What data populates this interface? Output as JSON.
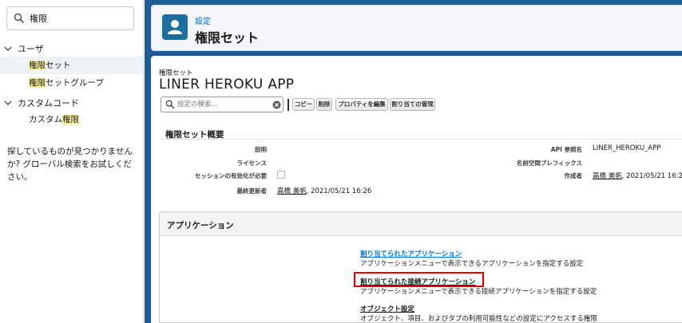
{
  "sidebar": {
    "search_value": "権限",
    "groups": [
      {
        "label": "ユーザ",
        "items": [
          "権限セット",
          "権限セットグループ"
        ]
      },
      {
        "label": "カスタムコード",
        "items": [
          "カスタム権限"
        ]
      }
    ],
    "help_text": "探しているものが見つかりませんか? グローバル検索をお試しください。"
  },
  "header": {
    "breadcrumb": "設定",
    "title": "権限セット"
  },
  "main": {
    "type_label": "権限セット",
    "name": "LINER HEROKU APP",
    "search_placeholder": "設定の検索...",
    "buttons": [
      "コピー",
      "削除",
      "プロパティを編集",
      "割り当ての管理"
    ],
    "overview": {
      "title": "権限セット概要",
      "left_fields": [
        {
          "label": "説明",
          "value": ""
        },
        {
          "label": "ライセンス",
          "value": ""
        },
        {
          "label": "セッションの有効化が必要",
          "value": ""
        },
        {
          "label": "最終更新者",
          "user": "高橋 美帆",
          "date": ", 2021/05/21 16:26"
        }
      ],
      "right_fields": [
        {
          "label": "API 参照名",
          "value": "LINER_HEROKU_APP"
        },
        {
          "label": "名前空間プレフィックス",
          "value": ""
        },
        {
          "label": "作成者",
          "user": "高橋 美帆",
          "date": ", 2021/05/21 16:2"
        }
      ]
    },
    "applications": {
      "title": "アプリケーション",
      "items": [
        {
          "link": "割り当てられたアプリケーション",
          "desc": "アプリケーションメニューで表示できるアプリケーションを指定する設定"
        },
        {
          "link": "割り当てられた接続アプリケーション",
          "desc": "アプリケーションメニューで表示できる接続アプリケーションを指定する設定"
        },
        {
          "link": "オブジェクト設定",
          "desc": "オブジェクト、項目、およびタブの利用可能性などの設定にアクセスする権限"
        }
      ]
    }
  },
  "colors": {
    "link_blue": "#0070d2",
    "header_blue": "#1f5b94",
    "highlight": "#fff59d",
    "callout_red": "#e00000"
  }
}
